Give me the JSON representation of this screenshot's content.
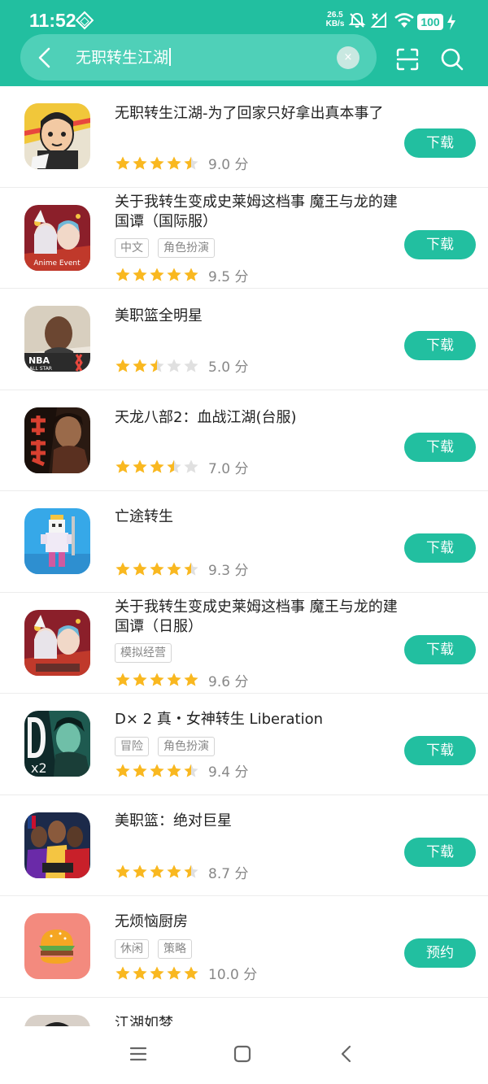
{
  "status_bar": {
    "time": "11:52",
    "net_speed_value": "26.5",
    "net_speed_unit": "KB/s",
    "battery": "100"
  },
  "search": {
    "query": "无职转生江湖",
    "clear_symbol": "×"
  },
  "colors": {
    "accent": "#22bfa0",
    "star": "#f9b820",
    "star_empty": "#e0e0e0"
  },
  "results": [
    {
      "name": "无职转生江湖-为了回家只好拿出真本事了",
      "tags": [],
      "rating": 4.5,
      "score": "9.0 分",
      "button": "下载",
      "icon": "anime-boy-icon"
    },
    {
      "name": "关于我转生变成史莱姆这档事 魔王与龙的建国谭（国际服）",
      "tags": [
        "中文",
        "角色扮演"
      ],
      "rating": 5,
      "score": "9.5 分",
      "button": "下载",
      "icon": "slime-anime-icon"
    },
    {
      "name": "美职篮全明星",
      "tags": [],
      "rating": 2.5,
      "score": "5.0 分",
      "button": "下载",
      "icon": "nba-allstar-icon"
    },
    {
      "name": "天龙八部2：血战江湖(台服)",
      "tags": [],
      "rating": 3.5,
      "score": "7.0 分",
      "button": "下载",
      "icon": "warrior-icon"
    },
    {
      "name": "亡途转生",
      "tags": [],
      "rating": 4.5,
      "score": "9.3 分",
      "button": "下载",
      "icon": "pixel-king-icon"
    },
    {
      "name": "关于我转生变成史莱姆这档事 魔王与龙的建国谭（日服）",
      "tags": [
        "模拟经营"
      ],
      "rating": 5,
      "score": "9.6 分",
      "button": "下载",
      "icon": "slime-anime-icon"
    },
    {
      "name": "D× 2 真・女神转生 Liberation",
      "tags": [
        "冒险",
        "角色扮演"
      ],
      "rating": 4.5,
      "score": "9.4 分",
      "button": "下载",
      "icon": "dx2-icon"
    },
    {
      "name": "美职篮：绝对巨星",
      "tags": [],
      "rating": 4.5,
      "score": "8.7 分",
      "button": "下载",
      "icon": "nba-stars-icon"
    },
    {
      "name": "无烦恼厨房",
      "tags": [
        "休闲",
        "策略"
      ],
      "rating": 5,
      "score": "10.0 分",
      "button": "预约",
      "icon": "burger-icon"
    },
    {
      "name": "江湖如梦",
      "tags": [],
      "rating": 0,
      "score": "",
      "button": "",
      "icon": "portrait-icon"
    }
  ]
}
